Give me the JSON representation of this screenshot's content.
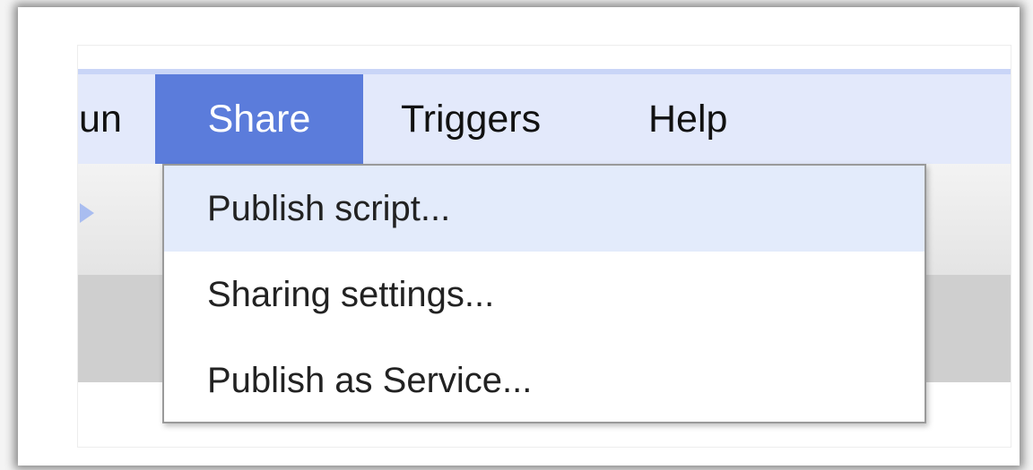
{
  "menubar": {
    "items": [
      {
        "label": "Run"
      },
      {
        "label": "Share",
        "active": true
      },
      {
        "label": "Triggers"
      },
      {
        "label": "Help"
      }
    ]
  },
  "share_menu": {
    "items": [
      {
        "label": "Publish script...",
        "highlighted": true
      },
      {
        "label": "Sharing settings..."
      },
      {
        "label": "Publish as Service..."
      }
    ]
  },
  "colors": {
    "menubar_bg": "#e3e9fb",
    "active_menu_bg": "#5b7cdb",
    "highlight_item_bg": "#e3ebfb"
  },
  "icons": {
    "toolbar_arrow": "run-arrow-icon"
  }
}
